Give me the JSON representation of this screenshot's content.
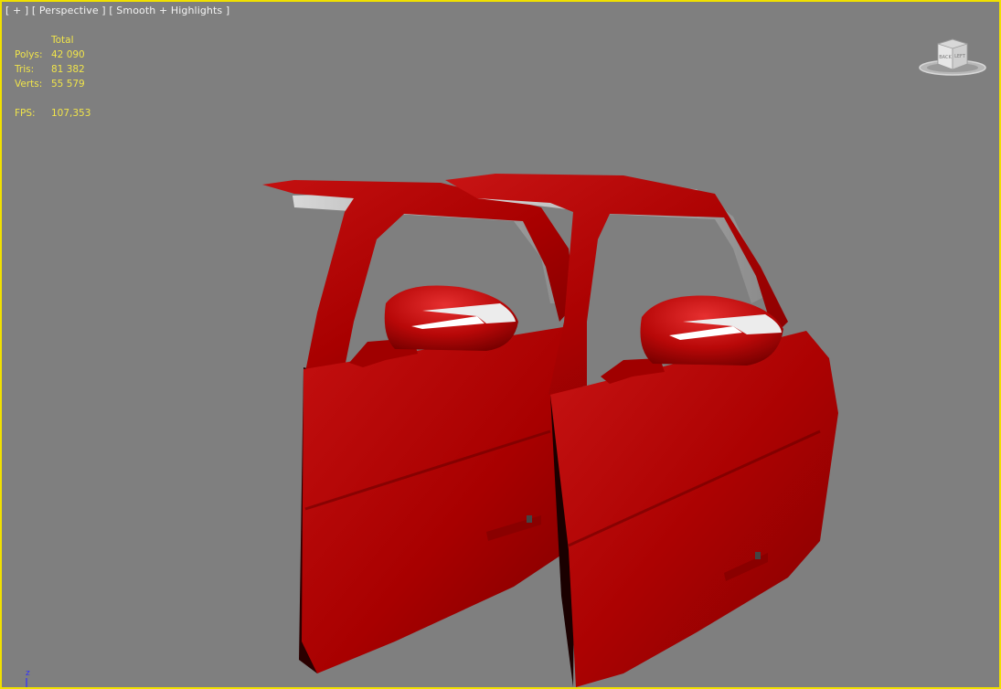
{
  "viewport": {
    "label": {
      "plus": "[ + ]",
      "view": "[ Perspective ]",
      "shading": "[ Smooth + Highlights ]"
    },
    "border_color": "#f0e000",
    "background_color": "#7f7f7f"
  },
  "statistics": {
    "header": "Total",
    "rows": [
      {
        "label": "Polys:",
        "value": "42 090"
      },
      {
        "label": "Tris:",
        "value": "81 382"
      },
      {
        "label": "Verts:",
        "value": "55 579"
      }
    ],
    "fps_label": "FPS:",
    "fps_value": "107,353",
    "text_color": "#f0e44a"
  },
  "viewcube": {
    "faces": [
      "BACK",
      "LEFT"
    ],
    "icon": "viewcube-icon"
  },
  "scene": {
    "objects": [
      "car-door-left",
      "car-door-right"
    ],
    "door_color": "#b00000",
    "mirror_stripe_color": "#ffffff"
  },
  "axis_tripod": {
    "label": "z",
    "color": "#3030ff"
  }
}
